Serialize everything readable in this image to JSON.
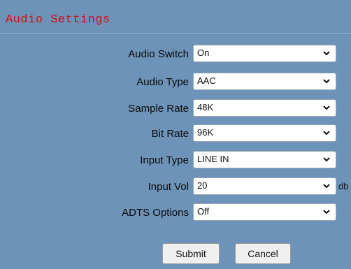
{
  "panel": {
    "title": "Audio Settings"
  },
  "fields": [
    {
      "label": "Audio Switch",
      "value": "On"
    },
    {
      "label": "Audio Type",
      "value": "AAC"
    },
    {
      "label": "Sample Rate",
      "value": "48K"
    },
    {
      "label": "Bit Rate",
      "value": "96K"
    },
    {
      "label": "Input Type",
      "value": "LINE IN"
    },
    {
      "label": "Input Vol",
      "value": "20",
      "unit": "db"
    },
    {
      "label": "ADTS Options",
      "value": "Off"
    }
  ],
  "buttons": {
    "submit": "Submit",
    "cancel": "Cancel"
  },
  "colors": {
    "background": "#6d93b8",
    "title": "#d10f0f"
  }
}
